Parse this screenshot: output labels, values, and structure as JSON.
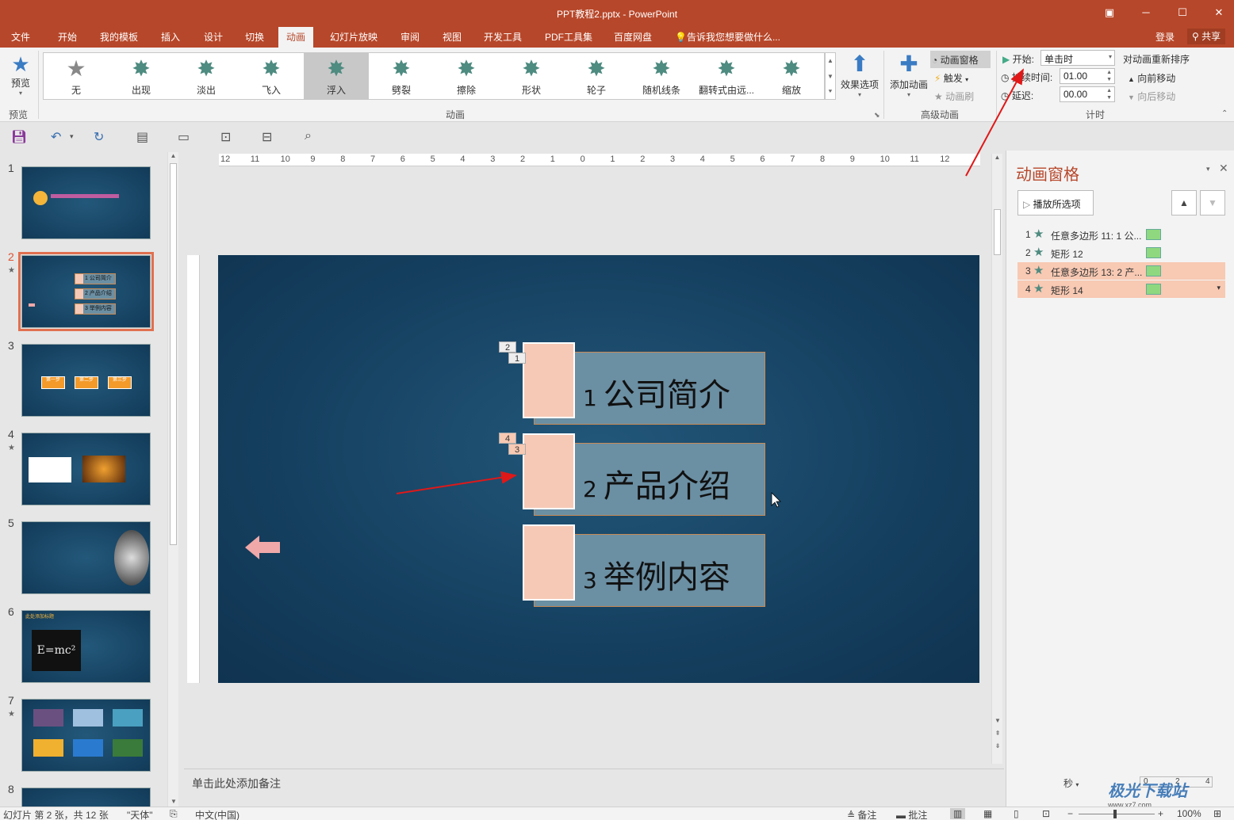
{
  "window": {
    "title": "PPT教程2.pptx - PowerPoint"
  },
  "tabs": [
    "文件",
    "开始",
    "我的模板",
    "插入",
    "设计",
    "切换",
    "动画",
    "幻灯片放映",
    "审阅",
    "视图",
    "开发工具",
    "PDF工具集",
    "百度网盘"
  ],
  "active_tab": "动画",
  "tell_me": "告诉我您想要做什么...",
  "account": {
    "login": "登录",
    "share": "共享"
  },
  "ribbon": {
    "preview": {
      "label": "预览",
      "group": "预览"
    },
    "gallery": {
      "items": [
        "无",
        "出现",
        "淡出",
        "飞入",
        "浮入",
        "劈裂",
        "擦除",
        "形状",
        "轮子",
        "随机线条",
        "翻转式由远...",
        "缩放"
      ],
      "selected": "浮入",
      "group": "动画"
    },
    "effect_options": "效果选项",
    "advanced": {
      "add_animation": "添加动画",
      "pane": "动画窗格",
      "trigger": "触发",
      "painter": "动画刷",
      "group": "高级动画"
    },
    "timing": {
      "start_label": "开始:",
      "start_value": "单击时",
      "duration_label": "持续时间:",
      "duration_value": "01.00",
      "delay_label": "延迟:",
      "delay_value": "00.00",
      "reorder": "对动画重新排序",
      "move_earlier": "向前移动",
      "move_later": "向后移动",
      "group": "计时"
    }
  },
  "ruler": {
    "h_ticks": [
      "12",
      "11",
      "10",
      "9",
      "8",
      "7",
      "6",
      "5",
      "4",
      "3",
      "2",
      "1",
      "0",
      "1",
      "2",
      "3",
      "4",
      "5",
      "6",
      "7",
      "8",
      "9",
      "10",
      "11",
      "12"
    ]
  },
  "thumbnails": [
    {
      "num": "1",
      "star": false
    },
    {
      "num": "2",
      "star": true,
      "selected": true,
      "items": [
        "1 公司简介",
        "2 产品介绍",
        "3 举例内容"
      ]
    },
    {
      "num": "3",
      "star": false,
      "items": [
        "第一步",
        "第二步",
        "第三步"
      ]
    },
    {
      "num": "4",
      "star": true
    },
    {
      "num": "5",
      "star": false
    },
    {
      "num": "6",
      "star": false,
      "title": "此处添加标题",
      "formula": "E=mc²"
    },
    {
      "num": "7",
      "star": true
    },
    {
      "num": "8",
      "star": false
    }
  ],
  "slide": {
    "items": [
      {
        "num": "1",
        "text": "公司简介",
        "tags": [
          "2",
          "1"
        ]
      },
      {
        "num": "2",
        "text": "产品介绍",
        "tags": [
          "4",
          "3"
        ]
      },
      {
        "num": "3",
        "text": "举例内容",
        "tags": []
      }
    ]
  },
  "notes_placeholder": "单击此处添加备注",
  "animation_pane": {
    "title": "动画窗格",
    "play": "播放所选项",
    "rows": [
      {
        "num": "1",
        "name": "任意多边形 11: 1 公...",
        "highlight": false
      },
      {
        "num": "2",
        "name": "矩形 12",
        "highlight": false
      },
      {
        "num": "3",
        "name": "任意多边形 13: 2 产...",
        "highlight": true
      },
      {
        "num": "4",
        "name": "矩形 14",
        "highlight": true
      }
    ],
    "seconds_label": "秒",
    "timeline": [
      "0",
      "2",
      "4"
    ]
  },
  "status": {
    "slide_info": "幻灯片 第 2 张，共 12 张",
    "theme": "\"天体\"",
    "language": "中文(中国)",
    "notes": "备注",
    "comments": "批注",
    "zoom": "100%"
  },
  "watermark": {
    "text": "极光下载站",
    "url": "www.xz7.com"
  },
  "colors": {
    "accent": "#b7472a",
    "selected_anim": "#f8c9b3",
    "slide_bg": "#153f5f"
  }
}
